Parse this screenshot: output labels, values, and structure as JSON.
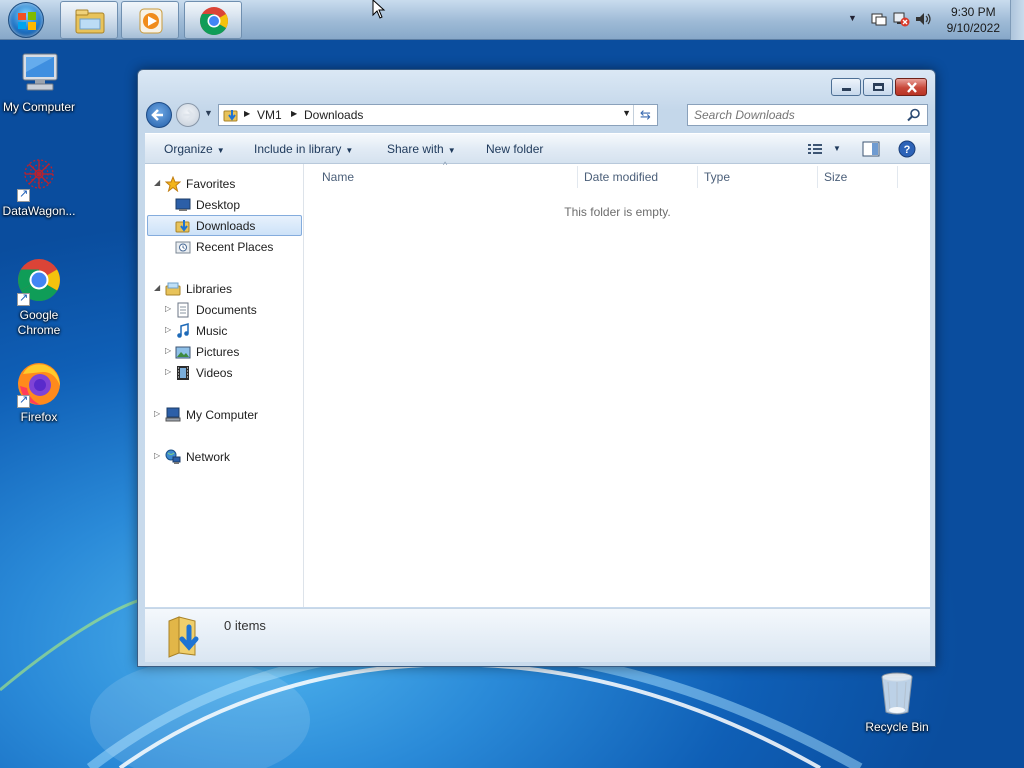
{
  "taskbar": {
    "clock_time": "9:30 PM",
    "clock_date": "9/10/2022",
    "pinned": [
      "windows-explorer",
      "media-player",
      "google-chrome"
    ]
  },
  "desktop_icons": [
    {
      "label": "My Computer",
      "icon": "computer-icon"
    },
    {
      "label": "DataWagon...",
      "icon": "datawagon-icon"
    },
    {
      "label": "Google Chrome",
      "icon": "chrome-icon"
    },
    {
      "label": "Firefox",
      "icon": "firefox-icon"
    },
    {
      "label": "Recycle Bin",
      "icon": "recycle-bin-icon"
    }
  ],
  "explorer": {
    "breadcrumb": [
      "VM1",
      "Downloads"
    ],
    "search_placeholder": "Search Downloads",
    "commands": {
      "organize": "Organize",
      "include_in_library": "Include in library",
      "share_with": "Share with",
      "new_folder": "New folder"
    },
    "nav": {
      "favorites": "Favorites",
      "desktop": "Desktop",
      "downloads": "Downloads",
      "recent_places": "Recent Places",
      "libraries": "Libraries",
      "documents": "Documents",
      "music": "Music",
      "pictures": "Pictures",
      "videos": "Videos",
      "my_computer": "My Computer",
      "network": "Network"
    },
    "selected_nav": "Downloads",
    "columns": [
      "Name",
      "Date modified",
      "Type",
      "Size"
    ],
    "empty_message": "This folder is empty.",
    "status_count": "0 items"
  },
  "colors": {
    "desktop_blue": "#1466c0",
    "selection_border": "#84acdd",
    "close_red": "#c8483a"
  }
}
